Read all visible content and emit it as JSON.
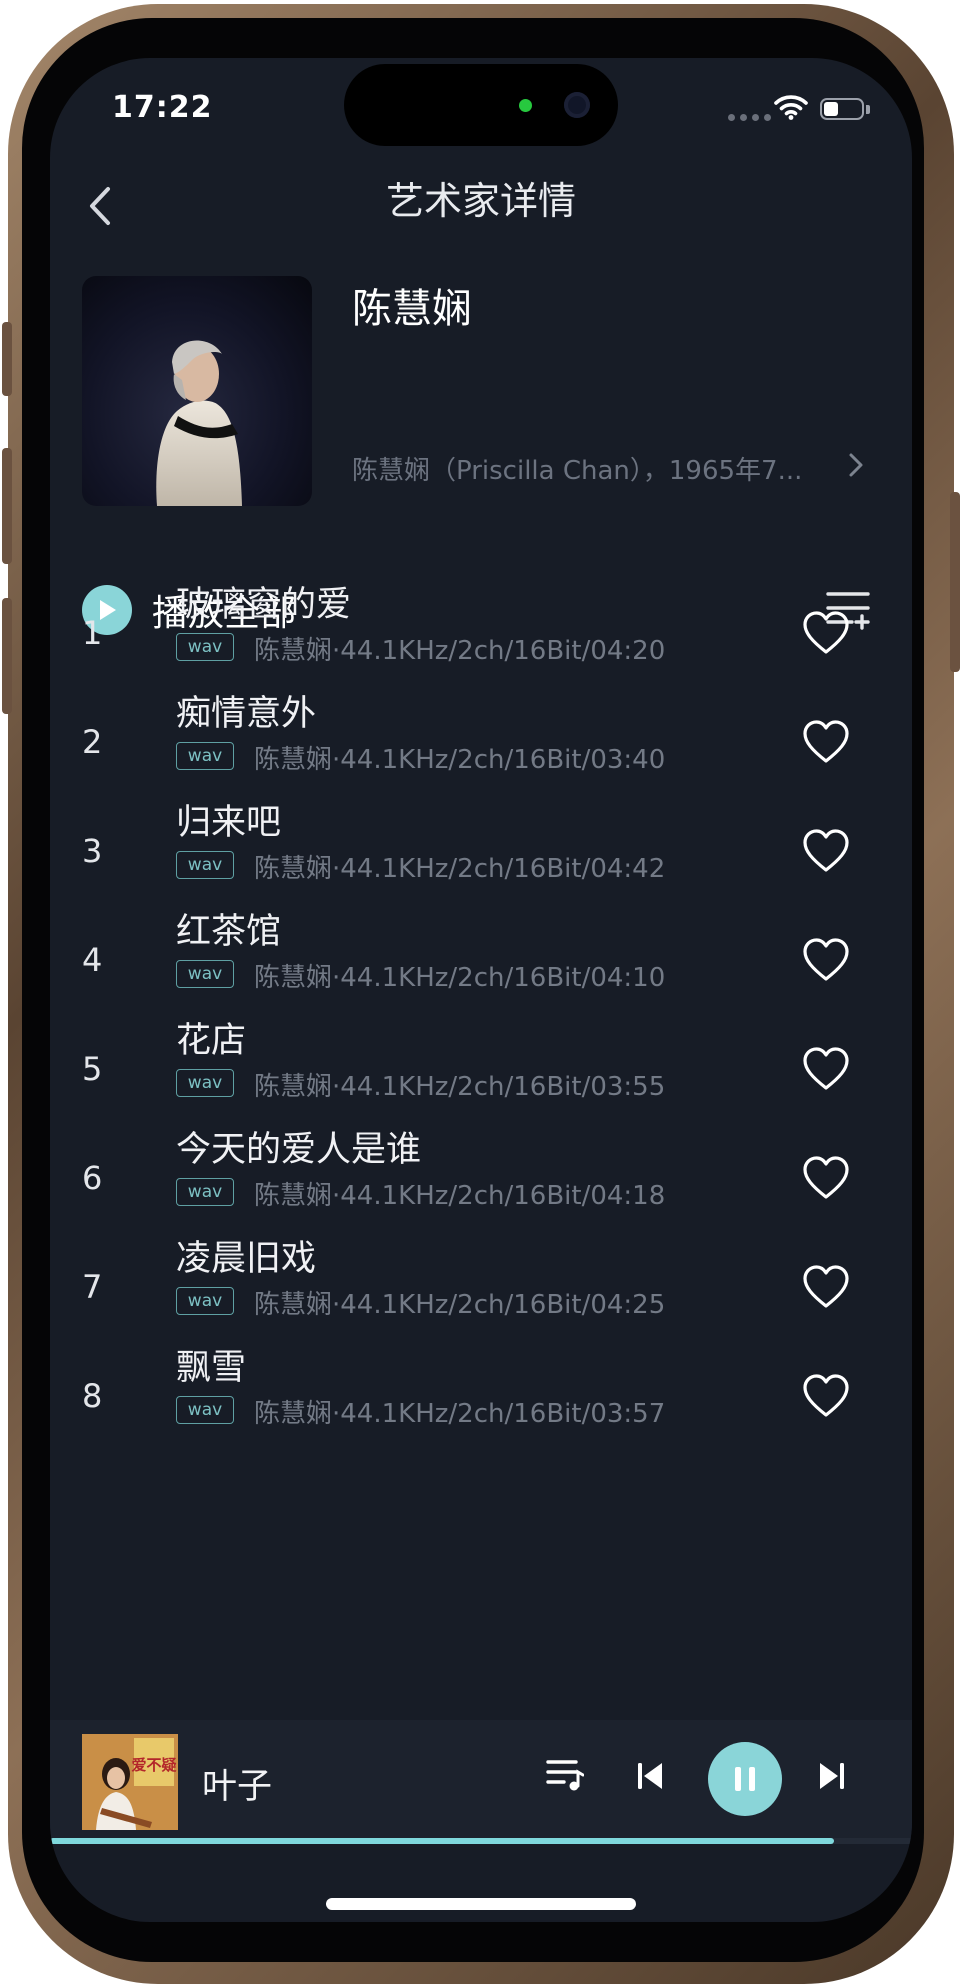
{
  "status_bar": {
    "time": "17:22"
  },
  "header": {
    "title": "艺术家详情"
  },
  "artist": {
    "name": "陈慧娴",
    "description": "陈慧娴（Priscilla Chan），1965年7..."
  },
  "play_all": {
    "label": "播放全部"
  },
  "songs": [
    {
      "index": "1",
      "title": "玻璃窗的爱",
      "format": "wav",
      "meta": "陈慧娴·44.1KHz/2ch/16Bit/04:20"
    },
    {
      "index": "2",
      "title": "痴情意外",
      "format": "wav",
      "meta": "陈慧娴·44.1KHz/2ch/16Bit/03:40"
    },
    {
      "index": "3",
      "title": "归来吧",
      "format": "wav",
      "meta": "陈慧娴·44.1KHz/2ch/16Bit/04:42"
    },
    {
      "index": "4",
      "title": "红茶馆",
      "format": "wav",
      "meta": "陈慧娴·44.1KHz/2ch/16Bit/04:10"
    },
    {
      "index": "5",
      "title": "花店",
      "format": "wav",
      "meta": "陈慧娴·44.1KHz/2ch/16Bit/03:55"
    },
    {
      "index": "6",
      "title": "今天的爱人是谁",
      "format": "wav",
      "meta": "陈慧娴·44.1KHz/2ch/16Bit/04:18"
    },
    {
      "index": "7",
      "title": "凌晨旧戏",
      "format": "wav",
      "meta": "陈慧娴·44.1KHz/2ch/16Bit/04:25"
    },
    {
      "index": "8",
      "title": "飘雪",
      "format": "wav",
      "meta": "陈慧娴·44.1KHz/2ch/16Bit/03:57"
    }
  ],
  "now_playing": {
    "title": "叶子",
    "cover_text": "爱不疑",
    "progress": 0.91,
    "state": "playing"
  },
  "colors": {
    "background": "#171c26",
    "accent": "#8ad5d8",
    "badge": "#5fa0a3",
    "secondary_text": "#737a86"
  },
  "icons": [
    "back-chevron-icon",
    "play-icon",
    "playlist-add-icon",
    "heart-icon",
    "queue-icon",
    "previous-icon",
    "pause-icon",
    "next-icon",
    "wifi-icon",
    "battery-icon"
  ]
}
